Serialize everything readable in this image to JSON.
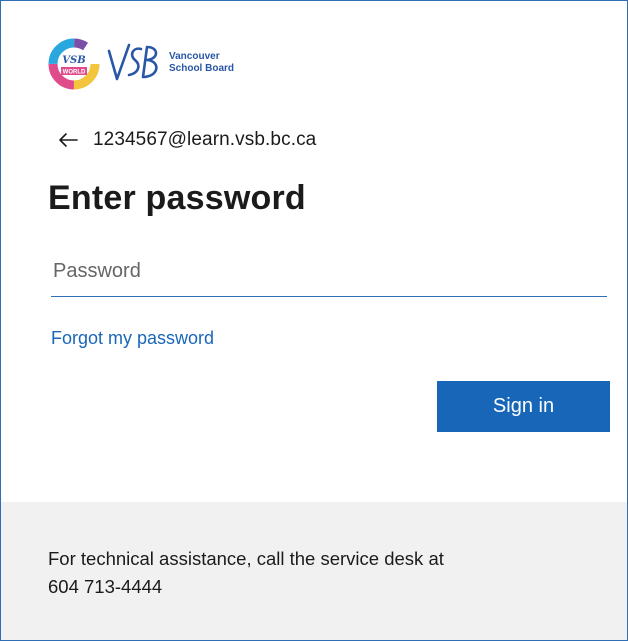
{
  "branding": {
    "circle_logo_text": "VSB WORLD",
    "vsb_mark": "VSB",
    "org_name_line1": "Vancouver",
    "org_name_line2": "School Board",
    "brand_color": "#2a56a8"
  },
  "identity": {
    "back_icon": "arrow-left-icon",
    "account": "1234567@learn.vsb.bc.ca"
  },
  "main": {
    "title": "Enter password",
    "password_placeholder": "Password",
    "password_value": "",
    "forgot_link": "Forgot my password",
    "signin_label": "Sign in"
  },
  "footer": {
    "line1": "For technical assistance, call the service desk at",
    "line2": "604 713-4444"
  },
  "colors": {
    "accent": "#1766b8",
    "frame_border": "#2f6db5",
    "footer_bg": "#f1f1f1",
    "text": "#1b1b1b"
  }
}
